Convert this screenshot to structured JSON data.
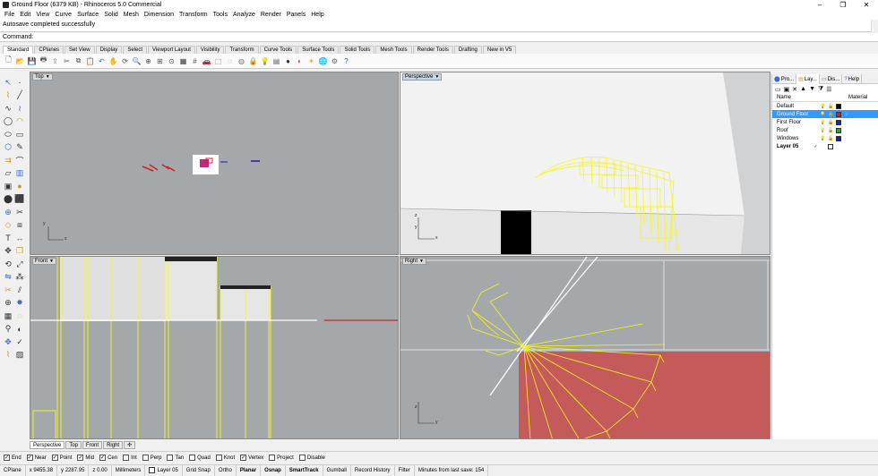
{
  "window": {
    "title": "Ground Floor (6379 KB) - Rhinoceros 5.0 Commercial",
    "buttons": [
      "–",
      "❐",
      "✕"
    ]
  },
  "menu": [
    "File",
    "Edit",
    "View",
    "Curve",
    "Surface",
    "Solid",
    "Mesh",
    "Dimension",
    "Transform",
    "Tools",
    "Analyze",
    "Render",
    "Panels",
    "Help"
  ],
  "history": {
    "line": "Autosave completed successfully"
  },
  "command": {
    "label": "Command:",
    "value": ""
  },
  "toolbar_tabs": [
    "Standard",
    "CPlanes",
    "Set View",
    "Display",
    "Select",
    "Viewport Layout",
    "Visibility",
    "Transform",
    "Curve Tools",
    "Surface Tools",
    "Solid Tools",
    "Mesh Tools",
    "Render Tools",
    "Drafting",
    "New in V5"
  ],
  "toolbar_icons": [
    "new-icon",
    "open-icon",
    "save-icon",
    "print-icon",
    "import-icon",
    "cut-icon",
    "copy-icon",
    "paste-icon",
    "undo-icon",
    "pan-icon",
    "rotate-view-icon",
    "zoom-dynamic-icon",
    "zoom-window-icon",
    "zoom-extents-icon",
    "zoom-selected-icon",
    "four-views-icon",
    "grid-icon",
    "car-icon",
    "select-all-icon",
    "hide-icon",
    "show-icon",
    "lock-icon",
    "light-icon",
    "layer-icon",
    "render-icon",
    "material-icon",
    "sun-icon",
    "globe-icon",
    "options-icon",
    "help-icon"
  ],
  "colors": {
    "viewport_bg": "#a5a8ab",
    "yellow": "#f7f719",
    "red_surface": "#c45a5a",
    "selected": "#3399ff"
  },
  "viewports": {
    "top": {
      "label": "Top",
      "axis_x": "x",
      "axis_y": "y"
    },
    "perspective": {
      "label": "Perspective",
      "axis_x": "x",
      "axis_y": "y",
      "axis_z": "z"
    },
    "front": {
      "label": "Front",
      "axis_x": "x",
      "axis_z": "z"
    },
    "right": {
      "label": "Right",
      "axis_y": "y",
      "axis_z": "z"
    }
  },
  "viewport_tabs": [
    "Perspective",
    "Top",
    "Front",
    "Right"
  ],
  "osnap": [
    {
      "label": "End",
      "checked": true
    },
    {
      "label": "Near",
      "checked": true
    },
    {
      "label": "Point",
      "checked": true
    },
    {
      "label": "Mid",
      "checked": true
    },
    {
      "label": "Cen",
      "checked": true
    },
    {
      "label": "Int",
      "checked": false
    },
    {
      "label": "Perp",
      "checked": false
    },
    {
      "label": "Tan",
      "checked": false
    },
    {
      "label": "Quad",
      "checked": false
    },
    {
      "label": "Knot",
      "checked": false
    },
    {
      "label": "Vertex",
      "checked": true
    },
    {
      "label": "Project",
      "checked": false
    },
    {
      "label": "Disable",
      "checked": false
    }
  ],
  "status": {
    "cplane": "CPlane",
    "x": "x 9455.38",
    "y": "y 2287.95",
    "z": "z 0.00",
    "units": "Millimeters",
    "layer": "Layer 05",
    "grid_snap": "Grid Snap",
    "ortho": "Ortho",
    "planar": "Planar",
    "osnap": "Osnap",
    "smarttrack": "SmartTrack",
    "gumball": "Gumball",
    "record_history": "Record History",
    "filter": "Filter",
    "save_info": "Minutes from last save: 154"
  },
  "panel": {
    "tabs": [
      "Pro...",
      "Lay...",
      "Dis...",
      "Help"
    ],
    "col_name": "Name",
    "col_material": "Material",
    "layers": [
      {
        "name": "Default",
        "color": "#000000",
        "selected": false,
        "current": false
      },
      {
        "name": "Ground Floor",
        "color": "#cc2222",
        "selected": true,
        "current": false
      },
      {
        "name": "First Floor",
        "color": "#2222aa",
        "selected": false,
        "current": false
      },
      {
        "name": "Roof",
        "color": "#22aa22",
        "selected": false,
        "current": false
      },
      {
        "name": "Windows",
        "color": "#1f1f9f",
        "selected": false,
        "current": false
      },
      {
        "name": "Layer 05",
        "color": "#ffffff",
        "selected": false,
        "current": true
      }
    ]
  }
}
